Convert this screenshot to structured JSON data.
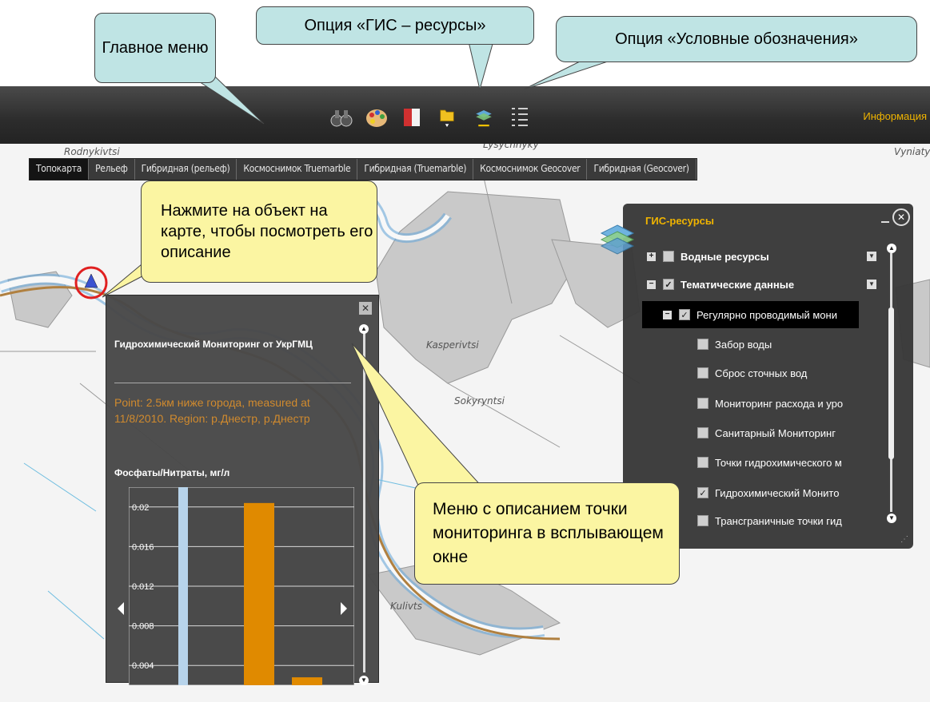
{
  "callouts": {
    "main_menu": "Главное меню",
    "gis_resources": "Опция «ГИС – ресурсы»",
    "legend": "Опция «Условные обозначения»",
    "click_object": "Нажмите на объект на карте, чтобы посмотреть его описание",
    "popup_menu": "Меню с описанием точки мониторинга в всплывающем окне"
  },
  "toolbar": {
    "icons": [
      "binoculars-icon",
      "palette-icon",
      "book-icon",
      "folder-icon",
      "layers-icon",
      "legend-list-icon"
    ],
    "info_link": "Информация"
  },
  "map_tabs": [
    "Топокарта",
    "Рельеф",
    "Гибридная (рельеф)",
    "Космоснимок Truemarble",
    "Гибридная (Truemarble)",
    "Космоснимок Geocover",
    "Гибридная (Geocover)"
  ],
  "map_labels": {
    "rodnykivtsi": "Rodnykivtsi",
    "lysychnyky": "Lysychnyky",
    "vyniatyntsi": "Vyniaty",
    "kasperivtsi": "Kasperivtsi",
    "sokyryntsi": "Sokyryntsi",
    "kulivtsi": "Kulivts"
  },
  "popup": {
    "title": "Гидрохимический Мониторинг от УкрГМЦ",
    "description": "Point: 2.5км ниже города, measured at 11/8/2010. Region: р.Днестр, р.Днестр",
    "chart_title": "Фосфаты/Нитраты, мг/л"
  },
  "gis_panel": {
    "title": "ГИС-ресурсы",
    "items": [
      {
        "label": "Водные ресурсы",
        "checked": false,
        "bold": true
      },
      {
        "label": "Тематические данные",
        "checked": true,
        "bold": true
      },
      {
        "label": "Регулярно проводимый мони",
        "checked": true
      },
      {
        "label": "Забор воды",
        "checked": false
      },
      {
        "label": "Сброс сточных вод",
        "checked": false
      },
      {
        "label": "Мониторинг расхода и уро",
        "checked": false
      },
      {
        "label": "Санитарный Мониторинг",
        "checked": false
      },
      {
        "label": "Точки гидрохимического м",
        "checked": false
      },
      {
        "label": "Гидрохимический Монито",
        "checked": true
      },
      {
        "label": "Трансграничные точки гид",
        "checked": false
      }
    ]
  },
  "chart_data": {
    "type": "bar",
    "title": "Фосфаты/Нитраты, мг/л",
    "ylim": [
      0.002,
      0.022
    ],
    "yticks": [
      "0.02",
      "0.016",
      "0.012",
      "0.008",
      "0.004"
    ],
    "ytick_values": [
      0.02,
      0.016,
      0.012,
      0.008,
      0.004
    ],
    "series": [
      {
        "values": [
          0.022
        ],
        "color": "#b7d3ea"
      },
      {
        "values": [
          0.0204
        ],
        "color": "#e08a00"
      },
      {
        "values": [
          0.0028
        ],
        "color": "#e08a00"
      }
    ]
  }
}
